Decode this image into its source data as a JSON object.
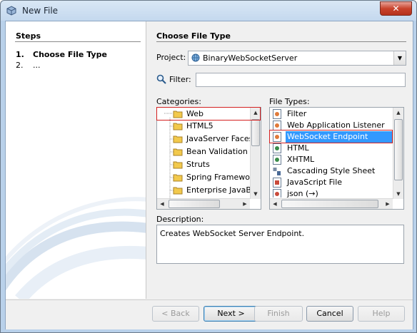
{
  "window": {
    "title": "New File",
    "close_label": "✕"
  },
  "steps": {
    "title": "Steps",
    "items": [
      {
        "num": "1.",
        "label": "Choose File Type"
      },
      {
        "num": "2.",
        "label": "..."
      }
    ]
  },
  "main": {
    "title": "Choose File Type",
    "project_label": "Project:",
    "project_value": "BinaryWebSocketServer",
    "filter_label": "Filter:",
    "filter_value": "",
    "categories_label": "Categories:",
    "categories": [
      "Web",
      "HTML5",
      "JavaServer Faces",
      "Bean Validation",
      "Struts",
      "Spring Framework",
      "Enterprise JavaBe"
    ],
    "file_types_label": "File Types:",
    "file_types": [
      "Filter",
      "Web Application Listener",
      "WebSocket Endpoint",
      "HTML",
      "XHTML",
      "Cascading Style Sheet",
      "JavaScript File",
      "json (→)"
    ],
    "description_label": "Description:",
    "description_text": "Creates WebSocket Server Endpoint."
  },
  "buttons": {
    "back": "< Back",
    "next": "Next >",
    "finish": "Finish",
    "cancel": "Cancel",
    "help": "Help"
  },
  "colors": {
    "selection": "#3399ff",
    "highlight_box": "#d42020",
    "title_bar": "#c4d8ee",
    "folder": "#f2c94c"
  }
}
